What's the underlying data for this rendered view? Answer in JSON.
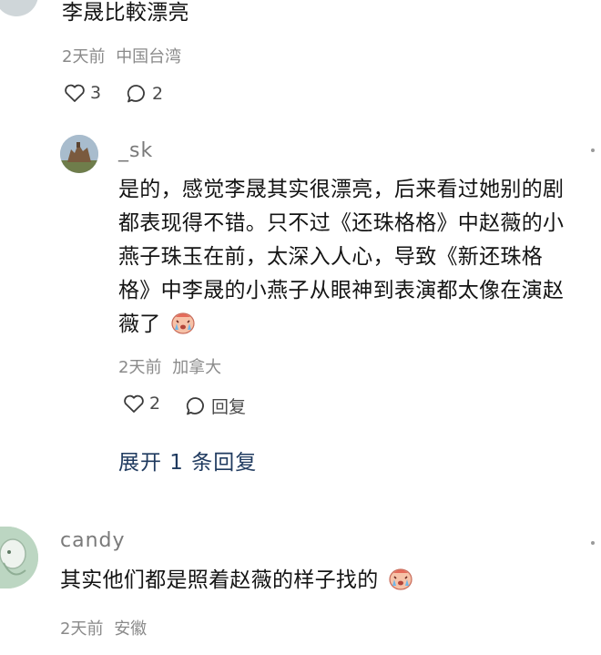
{
  "comment_top": {
    "text": "李晟比較漂亮",
    "time": "2天前",
    "location": "中国台湾",
    "likes": "3",
    "replies": "2"
  },
  "reply_sk": {
    "username": "_sk",
    "lines": [
      "是的，感觉李晟其实很漂亮，后来看过她别的剧",
      "都表现得不错。只不过《还珠格格》中赵薇的小",
      "燕子珠玉在前，太深入人心，导致《新还珠格",
      "格》中李晟的小燕子从眼神到表演都太像在演赵",
      "薇了"
    ],
    "emoji": "crying-face",
    "time": "2天前",
    "location": "加拿大",
    "likes": "2",
    "reply_label": "回复",
    "expand_label": "展开 1 条回复"
  },
  "comment_candy": {
    "username": "candy",
    "text": "其实他们都是照着赵薇的样子找的",
    "emoji": "crying-face",
    "time": "2天前",
    "location": "安徽"
  }
}
